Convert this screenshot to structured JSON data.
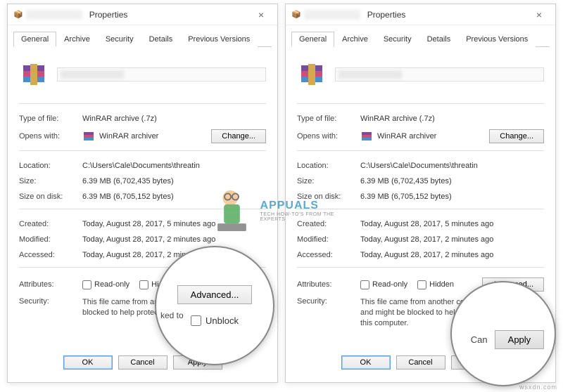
{
  "title": "Properties",
  "tabs": [
    "General",
    "Archive",
    "Security",
    "Details",
    "Previous Versions"
  ],
  "activeTab": 0,
  "fields": {
    "typeLabel": "Type of file:",
    "typeValue": "WinRAR archive (.7z)",
    "opensLabel": "Opens with:",
    "opensValue": "WinRAR archiver",
    "changeBtn": "Change...",
    "locationLabel": "Location:",
    "locationValue": "C:\\Users\\Cale\\Documents\\threatin",
    "sizeLabel": "Size:",
    "sizeValue": "6.39 MB (6,702,435 bytes)",
    "sizeDiskLabel": "Size on disk:",
    "sizeDiskValue": "6.39 MB (6,705,152 bytes)",
    "createdLabel": "Created:",
    "createdValue": "Today, August 28, 2017, 5 minutes ago",
    "modifiedLabel": "Modified:",
    "modifiedValue": "Today, August 28, 2017, 2 minutes ago",
    "accessedLabel": "Accessed:",
    "accessedValue": "Today, August 28, 2017, 2 minutes ago",
    "attrLabel": "Attributes:",
    "readOnly": "Read-only",
    "hidden": "Hidden",
    "advancedBtn": "Advanced...",
    "securityLabel": "Security:",
    "securityTextLeft": "This file came from another computer and might be blocked to help protect this computer.",
    "securityTextRight": "This file came from another computer and might be blocked to help protect this computer.",
    "unblock": "Unblock"
  },
  "footer": {
    "ok": "OK",
    "cancel": "Cancel",
    "apply": "Apply"
  },
  "zoom": {
    "advanced": "Advanced...",
    "unblock": "Unblock",
    "partial": "ked to",
    "cancelPartial": "Can",
    "apply": "Apply"
  },
  "watermark": "wsxdn.com",
  "logo": {
    "name": "APPUALS",
    "sub": "TECH HOW-TO'S FROM THE EXPERTS"
  }
}
